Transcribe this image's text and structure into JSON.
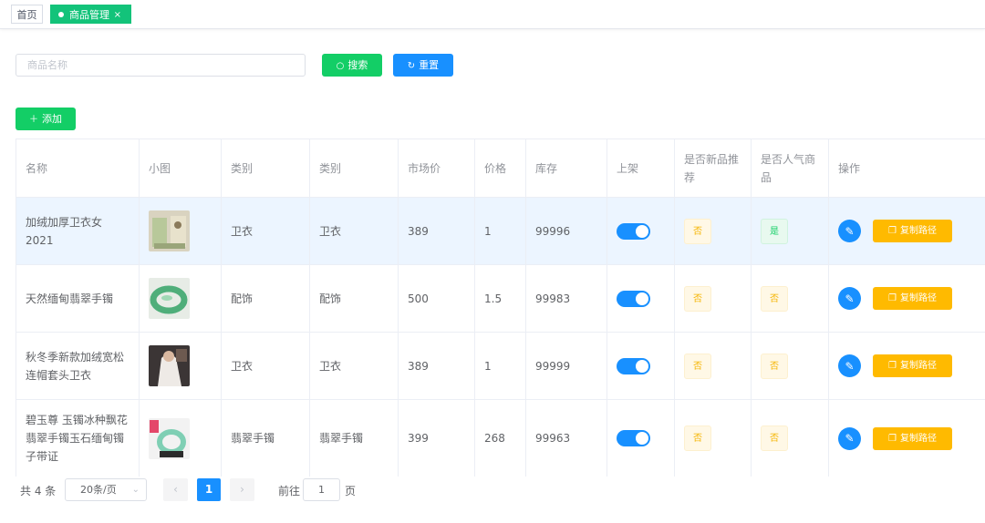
{
  "tabs": {
    "home": "首页",
    "active": "商品管理",
    "close": "×"
  },
  "search": {
    "placeholder": "商品名称",
    "search_label": "搜索",
    "reset_label": "重置",
    "add_label": "添加"
  },
  "colors": {
    "green": "#13ce66",
    "blue": "#1890ff",
    "orange": "#ffba00",
    "row_highlight": "#ecf5ff"
  },
  "icons": {
    "search": "search-icon",
    "reset": "refresh-icon",
    "add": "plus-icon",
    "edit": "pencil-icon",
    "copy": "copy-icon"
  },
  "table": {
    "headers": [
      "名称",
      "小图",
      "类别",
      "类别",
      "市场价",
      "价格",
      "库存",
      "上架",
      "是否新品推荐",
      "是否人气商品",
      "操作"
    ],
    "rows": [
      {
        "name": "加绒加厚卫衣女2021",
        "image": "sweatshirt-photo",
        "category1": "卫衣",
        "category2": "卫衣",
        "market_price": "389",
        "price": "1",
        "stock": "99996",
        "on_shelf": true,
        "is_new": "否",
        "is_popular": "是",
        "copy": "复制路径",
        "highlight": true
      },
      {
        "name": "天然缅甸翡翠手镯",
        "image": "jade-bracelet-photo",
        "category1": "配饰",
        "category2": "配饰",
        "market_price": "500",
        "price": "1.5",
        "stock": "99983",
        "on_shelf": true,
        "is_new": "否",
        "is_popular": "否",
        "copy": "复制路径",
        "highlight": false
      },
      {
        "name": "秋冬季新款加绒宽松连帽套头卫衣",
        "image": "hoodie-photo",
        "category1": "卫衣",
        "category2": "卫衣",
        "market_price": "389",
        "price": "1",
        "stock": "99999",
        "on_shelf": true,
        "is_new": "否",
        "is_popular": "否",
        "copy": "复制路径",
        "highlight": false
      },
      {
        "name": "碧玉尊 玉镯冰种飘花翡翠手镯玉石缅甸镯子带证",
        "image": "jade-bangle-photo",
        "category1": "翡翠手镯",
        "category2": "翡翠手镯",
        "market_price": "399",
        "price": "268",
        "stock": "99963",
        "on_shelf": true,
        "is_new": "否",
        "is_popular": "否",
        "copy": "复制路径",
        "highlight": false
      }
    ]
  },
  "pagination": {
    "total": "共 4 条",
    "page_size": "20条/页",
    "prev": "‹",
    "current": "1",
    "next": "›",
    "goto": "前往",
    "goto_value": "1",
    "page_suffix": "页"
  }
}
